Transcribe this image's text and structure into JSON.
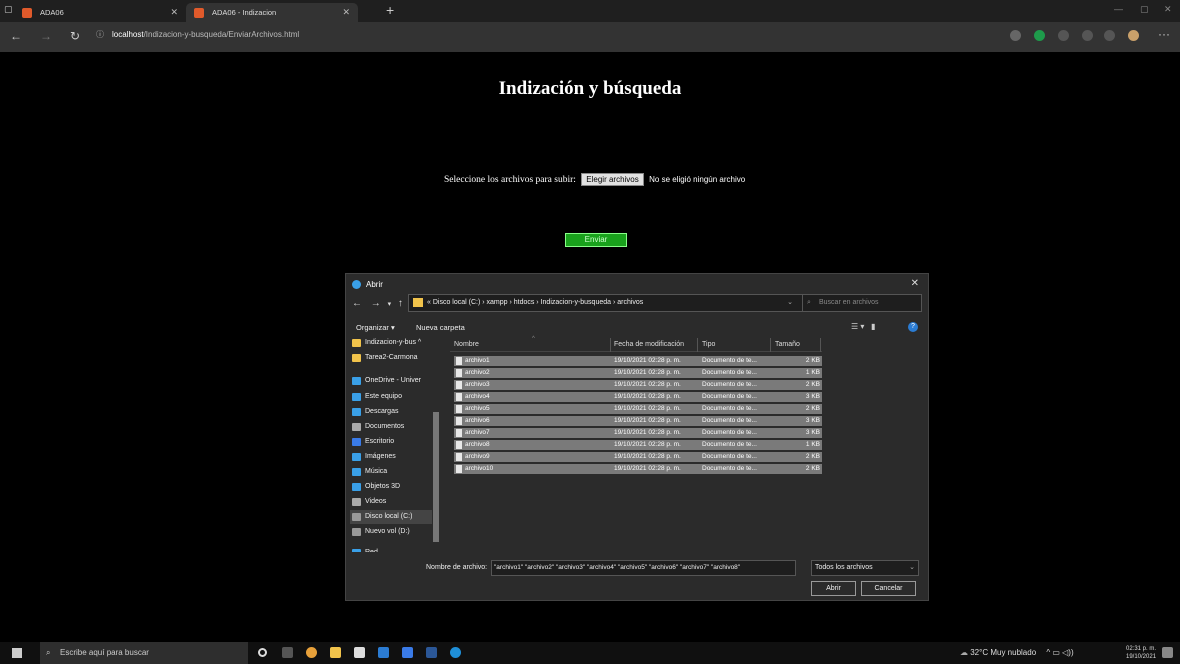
{
  "browser": {
    "tabs": [
      {
        "label": "ADA06",
        "active": false
      },
      {
        "label": "ADA06 - Indizacion",
        "active": true
      }
    ],
    "url_host": "localhost",
    "url_path": "/Indizacion-y-busqueda/EnviarArchivos.html"
  },
  "page": {
    "title": "Indización y búsqueda",
    "file_prompt": "Seleccione los archivos para subir:",
    "choose_label": "Elegir archivos",
    "no_file_text": "No se eligió ningún archivo",
    "submit_label": "Enviar"
  },
  "dialog": {
    "title": "Abrir",
    "breadcrumb": "« Disco local (C:)  ›  xampp  ›  htdocs  ›  Indizacion-y-busqueda  ›  archivos",
    "search_placeholder": "Buscar en archivos",
    "organize_label": "Organizar ▾",
    "new_folder_label": "Nueva carpeta",
    "nav_items": [
      {
        "label": "Indizacion-y-bus ^",
        "icon": "folder-icon",
        "color": "#f1c34b"
      },
      {
        "label": "Tarea2-Carmona",
        "icon": "folder-icon",
        "color": "#f1c34b"
      },
      {
        "label": "OneDrive - Univer",
        "icon": "cloud-icon",
        "color": "#3aa0e8"
      },
      {
        "label": "Este equipo",
        "icon": "computer-icon",
        "color": "#3aa0e8"
      },
      {
        "label": "Descargas",
        "icon": "download-icon",
        "color": "#3aa0e8"
      },
      {
        "label": "Documentos",
        "icon": "documents-icon",
        "color": "#aaaaaa"
      },
      {
        "label": "Escritorio",
        "icon": "desktop-icon",
        "color": "#3a7be8"
      },
      {
        "label": "Imágenes",
        "icon": "pictures-icon",
        "color": "#3aa0e8"
      },
      {
        "label": "Música",
        "icon": "music-icon",
        "color": "#3aa0e8"
      },
      {
        "label": "Objetos 3D",
        "icon": "objects-3d-icon",
        "color": "#3aa0e8"
      },
      {
        "label": "Videos",
        "icon": "videos-icon",
        "color": "#aaaaaa"
      },
      {
        "label": "Disco local (C:)",
        "icon": "drive-icon",
        "color": "#999999",
        "selected": true
      },
      {
        "label": "Nuevo vol (D:)",
        "icon": "drive-icon",
        "color": "#999999"
      },
      {
        "label": "Red",
        "icon": "network-icon",
        "color": "#3aa0e8"
      }
    ],
    "columns": [
      "Nombre",
      "Fecha de modificación",
      "Tipo",
      "Tamaño"
    ],
    "files": [
      {
        "name": "archivo1",
        "date": "19/10/2021 02:28 p. m.",
        "type": "Documento de te...",
        "size": "2 KB"
      },
      {
        "name": "archivo2",
        "date": "19/10/2021 02:28 p. m.",
        "type": "Documento de te...",
        "size": "1 KB"
      },
      {
        "name": "archivo3",
        "date": "19/10/2021 02:28 p. m.",
        "type": "Documento de te...",
        "size": "2 KB"
      },
      {
        "name": "archivo4",
        "date": "19/10/2021 02:28 p. m.",
        "type": "Documento de te...",
        "size": "3 KB"
      },
      {
        "name": "archivo5",
        "date": "19/10/2021 02:28 p. m.",
        "type": "Documento de te...",
        "size": "2 KB"
      },
      {
        "name": "archivo6",
        "date": "19/10/2021 02:28 p. m.",
        "type": "Documento de te...",
        "size": "3 KB"
      },
      {
        "name": "archivo7",
        "date": "19/10/2021 02:28 p. m.",
        "type": "Documento de te...",
        "size": "3 KB"
      },
      {
        "name": "archivo8",
        "date": "19/10/2021 02:28 p. m.",
        "type": "Documento de te...",
        "size": "1 KB"
      },
      {
        "name": "archivo9",
        "date": "19/10/2021 02:28 p. m.",
        "type": "Documento de te...",
        "size": "2 KB"
      },
      {
        "name": "archivo10",
        "date": "19/10/2021 02:28 p. m.",
        "type": "Documento de te...",
        "size": "2 KB"
      }
    ],
    "filename_label": "Nombre de archivo:",
    "filename_value": "\"archivo1\" \"archivo2\" \"archivo3\" \"archivo4\" \"archivo5\" \"archivo6\" \"archivo7\" \"archivo8\"",
    "filetype_value": "Todos los archivos",
    "open_label": "Abrir",
    "cancel_label": "Cancelar"
  },
  "taskbar": {
    "search_placeholder": "Escribe aquí para buscar",
    "weather": "32°C  Muy nublado",
    "time": "02:31 p. m.",
    "date": "19/10/2021"
  }
}
